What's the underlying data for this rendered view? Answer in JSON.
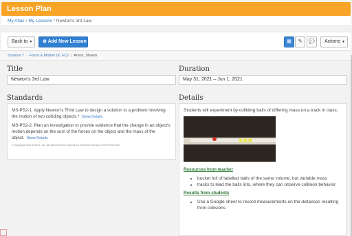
{
  "header": {
    "title": "Lesson Plan",
    "accent": "#f7a427"
  },
  "breadcrumbs": [
    "My Atlas",
    "My Lessons",
    "Newton's 3rd Law"
  ],
  "toolbar": {
    "back_label": "Back to",
    "add_label": "Add New Lesson",
    "actions_label": "Actions",
    "primary_color": "#2f7fd3"
  },
  "tags": [
    "Science 7",
    "Force & Motion (K. ED)",
    "Amos, Shawn"
  ],
  "title_field": {
    "label": "Title",
    "value": "Newton's 3rd Law"
  },
  "duration_field": {
    "label": "Duration",
    "value": "May 31, 2021 – Jun 1, 2021"
  },
  "standards": {
    "heading": "Standards",
    "items": [
      {
        "text": "MS-PS2-1. Apply Newton's Third Law to design a solution to a problem involving the motion of two colliding objects.*",
        "link": "Show Details"
      },
      {
        "text": "MS-PS2-2. Plan an investigation to provide evidence that the change in an object's motion depends on the sum of the forces on the object and the mass of the object.",
        "link": "Show Details"
      }
    ],
    "copyright": "© Copyright 2013 Achieve, Inc. All rights reserved. Access the interactive version of the NGSS here"
  },
  "details": {
    "heading": "Details",
    "intro": "Students will experiment by colliding balls of differing mass on a track in class.",
    "resources_heading": "Resources from teacher",
    "resources": [
      "bucket full of labelled balls of the same volume, but variable mass",
      "tracks to lead the balls into, where they can observe collision behavior"
    ],
    "results_heading": "Results from students",
    "results": [
      "Use a Google sheet to record measurements on the distances resulting from collisions"
    ]
  }
}
